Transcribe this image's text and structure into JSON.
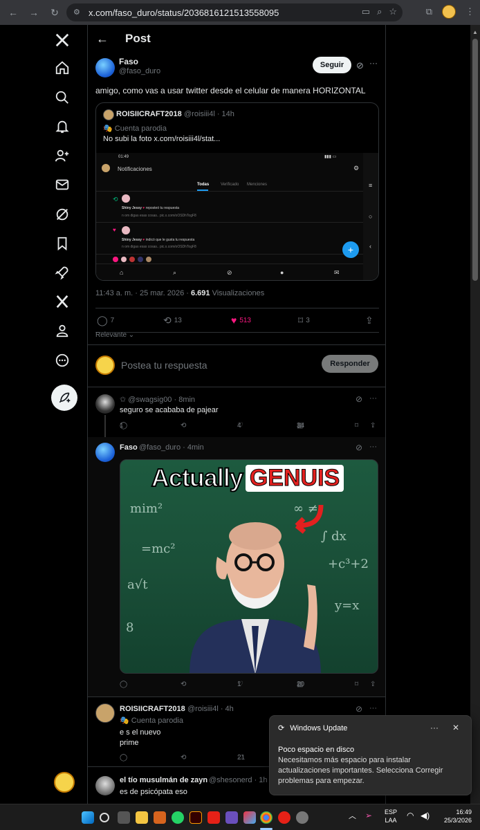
{
  "browser": {
    "url": "x.com/faso_duro/status/2036816121513558095"
  },
  "header": {
    "title": "Post"
  },
  "post": {
    "author_name": "Faso",
    "author_handle": "@faso_duro",
    "follow_label": "Seguir",
    "text": "amigo, como vas a usar twitter desde el celular de manera HORIZONTAL",
    "time": "11:43 a. m. · 25 mar. 2026 · ",
    "views_count": "6.691",
    "views_label": " Visualizaciones",
    "replies": "7",
    "reposts": "13",
    "likes": "513",
    "bookmarks": "3",
    "sort_label": "Relevante"
  },
  "quote": {
    "name": "ROISIICRAFT2018",
    "handle_time": "@roisiii4l · 14h",
    "tag": "Cuenta parodia",
    "text": "No subi la foto  x.com/roisiii4l/stat...",
    "shot": {
      "status_time": "01:49",
      "title": "Notificaciones",
      "tabs": [
        "Todas",
        "Verificado",
        "Menciones"
      ],
      "n1_user": "Shiny Jessy",
      "n1_action": "reposteó tu respuesta",
      "n1_sub": "n om digas esas cosas.. pic.x.com/oOSDhTogF8",
      "n2_user": "Shiny Jessy",
      "n2_action": "indicó que le gusta tu respuesta",
      "n2_sub": "n om digas esas cosas.. pic.x.com/oOSDhTogF8"
    }
  },
  "compose": {
    "placeholder": "Postea tu respuesta",
    "button": "Responder"
  },
  "replies": [
    {
      "name": "",
      "handle_time": "@swagsig00 · 8min",
      "text": "seguro se acababa de pajear",
      "replies": "1",
      "likes": "4",
      "views": "34"
    },
    {
      "name": "Faso",
      "handle_time": "@faso_duro · 4min",
      "meme_word1": "Actually",
      "meme_word2": "GENUIS",
      "likes": "1",
      "views": "20"
    },
    {
      "name": "ROISIICRAFT2018",
      "handle_time": "@roisiii4l · 4h",
      "tag": "Cuenta parodia",
      "text_line1": "e s el nuevo",
      "text_line2": "prime",
      "likes": "21"
    },
    {
      "name": "el tío musulmán de zayn",
      "handle_time": "@shesonerd · 1h",
      "text": "es de psicópata eso"
    }
  ],
  "toast": {
    "app": "Windows Update",
    "title": "Poco espacio en disco",
    "body": "Necesitamos más espacio para instalar actualizaciones importantes. Selecciona Corregir problemas para empezar."
  },
  "taskbar": {
    "lang1": "ESP",
    "lang2": "LAA",
    "time": "16:49",
    "date": "25/3/2026"
  }
}
